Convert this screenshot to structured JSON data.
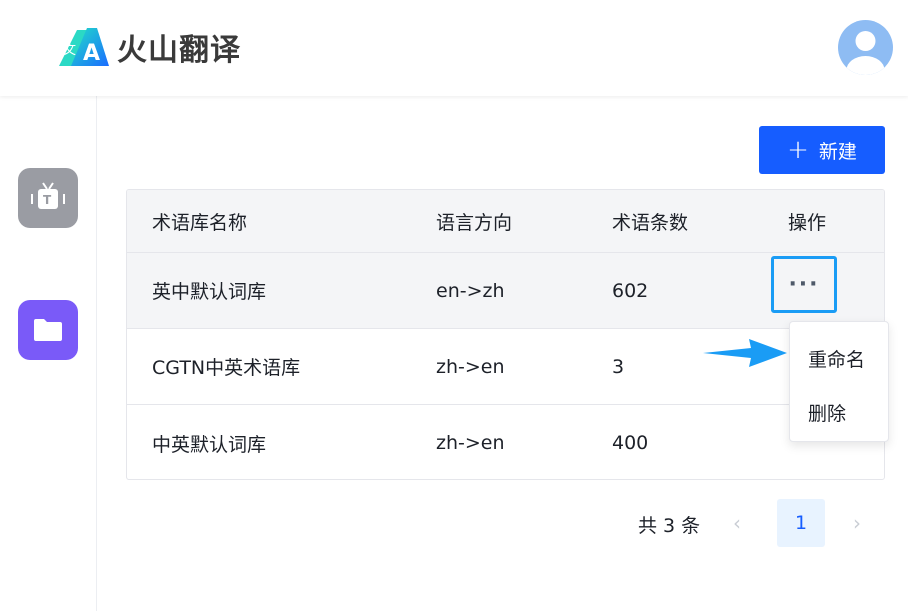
{
  "header": {
    "logo_text": "火山翻译",
    "logo_glyph_a": "A",
    "logo_glyph_zh": "文"
  },
  "sidebar": {
    "items": [
      {
        "icon": "tv-translate-icon",
        "color": "#9a9ca3",
        "glyph": "T"
      },
      {
        "icon": "folder-icon",
        "color": "#7a5af8"
      }
    ]
  },
  "toolbar": {
    "new_label": "新建",
    "new_icon": "+"
  },
  "table": {
    "columns": [
      "术语库名称",
      "语言方向",
      "术语条数",
      "操作"
    ],
    "rows": [
      {
        "name": "英中默认词库",
        "direction": "en->zh",
        "count": "602"
      },
      {
        "name": "CGTN中英术语库",
        "direction": "zh->en",
        "count": "3"
      },
      {
        "name": "中英默认词库",
        "direction": "zh->en",
        "count": "400"
      }
    ],
    "more_label": "···"
  },
  "dropdown": {
    "items": [
      "重命名",
      "删除"
    ]
  },
  "pagination": {
    "total_text": "共 3 条",
    "prev": "‹",
    "current_page": "1",
    "next": "›"
  },
  "colors": {
    "primary": "#165dff",
    "highlight_border": "#1a9cf5",
    "arrow": "#1a9cf5"
  }
}
